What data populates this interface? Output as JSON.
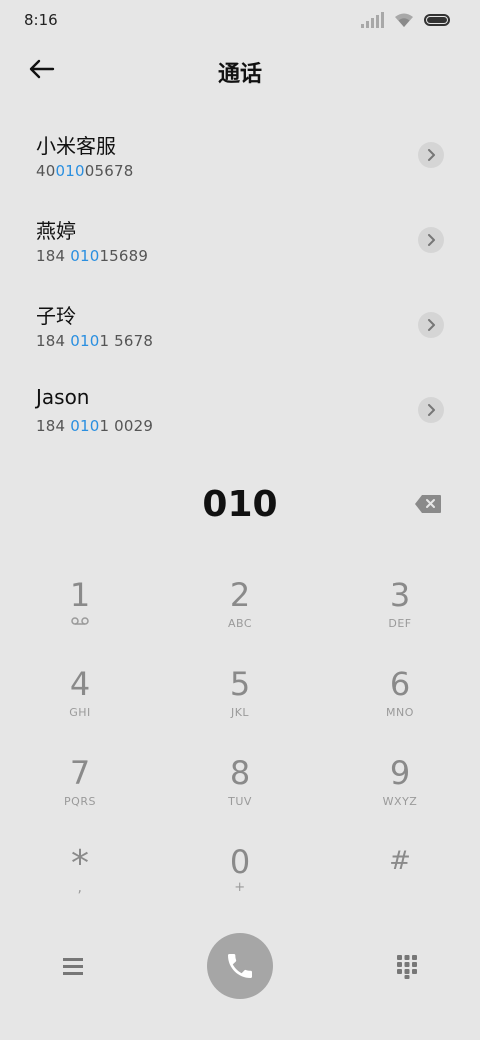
{
  "status": {
    "time": "8:16"
  },
  "header": {
    "title": "通话"
  },
  "contacts": [
    {
      "name": "小米客服",
      "number_pre": "40",
      "number_match": "010",
      "number_post": "05678"
    },
    {
      "name": "燕婷",
      "number_pre": "184 ",
      "number_match": "010",
      "number_post": "15689"
    },
    {
      "name": "子玲",
      "number_pre": "184 ",
      "number_match": "010",
      "number_post": "1 5678"
    },
    {
      "name": "Jason",
      "number_pre": "184 ",
      "number_match": "010",
      "number_post": "1 0029"
    }
  ],
  "dialer": {
    "number": "010"
  },
  "keys": [
    {
      "digit": "1",
      "letters": ""
    },
    {
      "digit": "2",
      "letters": "ABC"
    },
    {
      "digit": "3",
      "letters": "DEF"
    },
    {
      "digit": "4",
      "letters": "GHI"
    },
    {
      "digit": "5",
      "letters": "JKL"
    },
    {
      "digit": "6",
      "letters": "MNO"
    },
    {
      "digit": "7",
      "letters": "PQRS"
    },
    {
      "digit": "8",
      "letters": "TUV"
    },
    {
      "digit": "9",
      "letters": "WXYZ"
    },
    {
      "digit": "*",
      "letters": ","
    },
    {
      "digit": "0",
      "letters": "+"
    },
    {
      "digit": "#",
      "letters": ""
    }
  ],
  "icons": {
    "back": "arrow-left-icon",
    "chevron": "chevron-right-icon",
    "backspace": "backspace-icon",
    "voicemail": "voicemail-icon",
    "menu": "menu-icon",
    "call": "phone-icon",
    "dialpad": "dialpad-icon"
  },
  "colors": {
    "highlight": "#2a8fe0",
    "call_button": "#a6a6a6",
    "background": "#e6e6e6"
  }
}
